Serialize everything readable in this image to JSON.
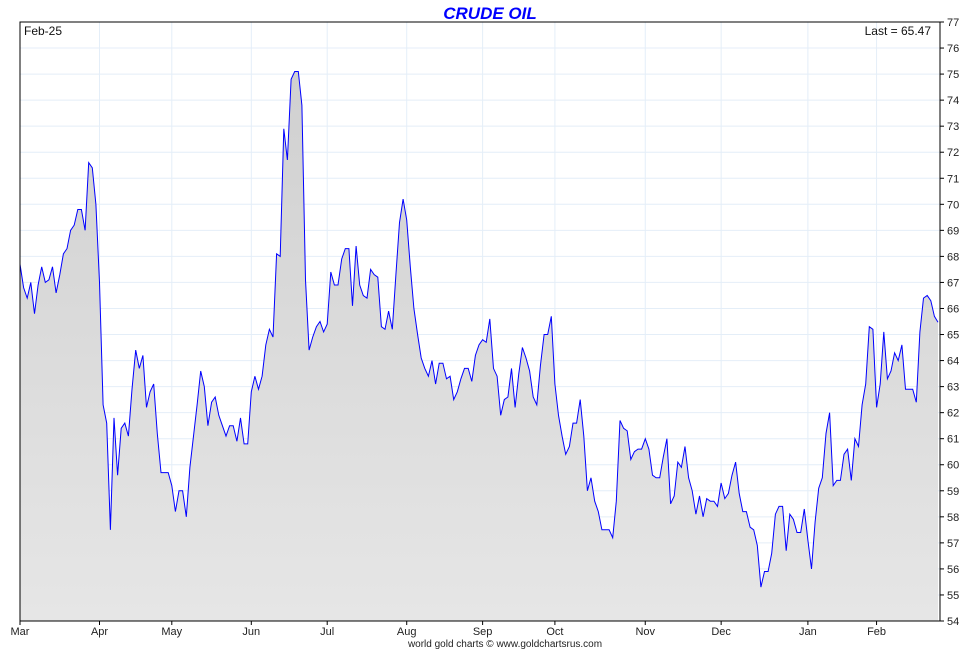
{
  "chart_data": {
    "type": "area",
    "title": "CRUDE OIL",
    "period_label": "Feb-25",
    "last_label": "Last = 65.47",
    "last_value": 65.47,
    "footer": "world gold charts © www.goldchartsrus.com",
    "xlabel": "",
    "ylabel": "",
    "ylim": [
      54,
      77
    ],
    "ytick_step": 1,
    "yaxis_side": "right",
    "grid": true,
    "colors": {
      "line": "#0000ff",
      "fill_top": "#d0d0d0",
      "fill_bottom": "#e6e6e6",
      "grid": "#e4eef8",
      "title": "#0000ff"
    },
    "months": [
      {
        "label": "Mar",
        "values": [
          67.7,
          66.8,
          66.4,
          67.0,
          65.8,
          66.9,
          67.6,
          67.0,
          67.1,
          67.6,
          66.6,
          67.3,
          68.1,
          68.3,
          69.0,
          69.2,
          69.8,
          69.8,
          69.0,
          71.6,
          71.4,
          70.0
        ]
      },
      {
        "label": "Apr",
        "values": [
          67.0,
          62.3,
          61.6,
          57.5,
          61.8,
          59.6,
          61.4,
          61.6,
          61.1,
          62.9,
          64.4,
          63.7,
          64.2,
          62.2,
          62.8,
          63.1,
          61.2,
          59.7,
          59.7,
          59.7
        ]
      },
      {
        "label": "May",
        "values": [
          59.2,
          58.2,
          59.0,
          59.0,
          58.0,
          59.9,
          61.1,
          62.3,
          63.6,
          63.0,
          61.5,
          62.4,
          62.6,
          61.9,
          61.5,
          61.1,
          61.5,
          61.5,
          60.9,
          61.8,
          60.8,
          60.8
        ]
      },
      {
        "label": "Jun",
        "values": [
          62.8,
          63.4,
          62.9,
          63.4,
          64.6,
          65.2,
          64.9,
          68.1,
          68.0,
          72.9,
          71.7,
          74.8,
          75.1,
          75.1,
          73.8,
          67.1,
          64.4,
          64.9,
          65.3,
          65.5,
          65.1
        ]
      },
      {
        "label": "Jul",
        "values": [
          65.4,
          67.4,
          66.9,
          66.9,
          67.9,
          68.3,
          68.3,
          66.1,
          68.4,
          66.9,
          66.5,
          66.4,
          67.5,
          67.3,
          67.2,
          65.3,
          65.2,
          65.9,
          65.2,
          67.3,
          69.3,
          70.2
        ]
      },
      {
        "label": "Aug",
        "values": [
          69.4,
          67.6,
          66.0,
          65.0,
          64.1,
          63.7,
          63.4,
          64.0,
          63.1,
          63.9,
          63.9,
          63.3,
          63.4,
          62.5,
          62.8,
          63.3,
          63.7,
          63.7,
          63.2,
          64.2,
          64.6
        ]
      },
      {
        "label": "Sep",
        "values": [
          64.8,
          64.7,
          65.6,
          63.7,
          63.4,
          61.9,
          62.5,
          62.6,
          63.7,
          62.2,
          63.5,
          64.5,
          64.1,
          63.6,
          62.6,
          62.3,
          63.8,
          65.0,
          65.0,
          65.7
        ]
      },
      {
        "label": "Oct",
        "values": [
          63.1,
          61.9,
          61.1,
          60.4,
          60.7,
          61.6,
          61.6,
          62.5,
          61.1,
          59.0,
          59.5,
          58.6,
          58.2,
          57.5,
          57.5,
          57.5,
          57.2,
          58.6,
          61.7,
          61.4,
          61.3,
          60.2,
          60.5,
          60.6,
          60.6
        ]
      },
      {
        "label": "Nov",
        "values": [
          61.0,
          60.6,
          59.6,
          59.5,
          59.5,
          60.3,
          61.0,
          58.5,
          58.8,
          60.1,
          59.9,
          60.7,
          59.5,
          59.0,
          58.1,
          58.8,
          58.0,
          58.7,
          58.6,
          58.6,
          58.4
        ]
      },
      {
        "label": "Dec",
        "values": [
          59.3,
          58.7,
          58.9,
          59.6,
          60.1,
          58.9,
          58.2,
          58.2,
          57.6,
          57.5,
          56.9,
          55.3,
          55.9,
          55.9,
          56.6,
          58.1,
          58.4,
          58.4,
          56.7,
          58.1,
          57.9,
          57.4,
          57.4,
          58.3
        ]
      },
      {
        "label": "Jan",
        "values": [
          57.1,
          56.0,
          57.8,
          59.1,
          59.5,
          61.2,
          62.0,
          59.2,
          59.4,
          59.4,
          60.4,
          60.6,
          59.4,
          61.0,
          60.7,
          62.3,
          63.1,
          65.3,
          65.2
        ]
      },
      {
        "label": "Feb",
        "values": [
          62.2,
          63.1,
          65.1,
          63.3,
          63.6,
          64.3,
          64.0,
          64.6,
          62.9,
          62.9,
          62.9,
          62.4,
          65.1,
          66.4,
          66.5,
          66.3,
          65.7,
          65.47
        ]
      }
    ]
  }
}
